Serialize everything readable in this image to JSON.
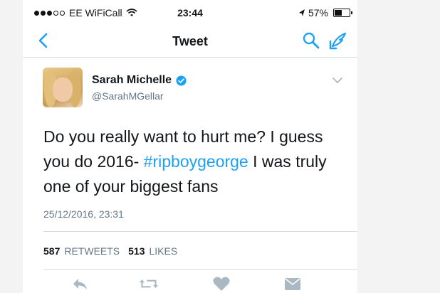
{
  "status_bar": {
    "carrier": "EE WiFiCall",
    "time": "23:44",
    "battery": "57%",
    "battery_level": 0.57
  },
  "nav": {
    "title": "Tweet"
  },
  "tweet": {
    "display_name": "Sarah Michelle",
    "handle": "@SarahMGellar",
    "text_before": "Do you really want to hurt me? I guess you do 2016- ",
    "hashtag": "#ripboygeorge",
    "text_after": " I was truly one of your biggest fans",
    "timestamp": "25/12/2016, 23:31",
    "retweets_count": "587",
    "retweets_label": "RETWEETS",
    "likes_count": "513",
    "likes_label": "LIKES"
  },
  "colors": {
    "accent": "#1da1f2",
    "secondary_text": "#657786",
    "action_icon": "#aab8c2"
  },
  "icons": [
    "back-icon",
    "search-icon",
    "compose-icon",
    "verified-icon",
    "chevron-down-icon",
    "reply-icon",
    "retweet-icon",
    "like-icon",
    "message-icon",
    "wifi-icon",
    "location-arrow-icon",
    "battery-icon"
  ]
}
